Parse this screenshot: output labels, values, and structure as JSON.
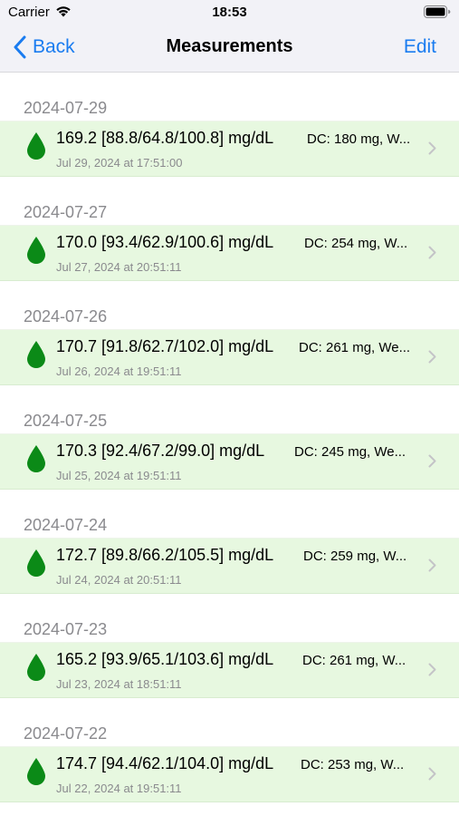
{
  "status_bar": {
    "carrier": "Carrier",
    "time": "18:53"
  },
  "nav": {
    "back_label": "Back",
    "title": "Measurements",
    "edit_label": "Edit"
  },
  "colors": {
    "accent": "#1a7cf0",
    "row_background": "#e7f8e0",
    "drop_green": "#0b8a17"
  },
  "sections": [
    {
      "header": "2024-07-29",
      "title": "169.2 [88.8/64.8/100.8] mg/dL",
      "detail": "DC: 180 mg, W...",
      "subtitle": "Jul 29, 2024 at 17:51:00"
    },
    {
      "header": "2024-07-27",
      "title": "170.0 [93.4/62.9/100.6] mg/dL",
      "detail": "DC: 254 mg, W...",
      "subtitle": "Jul 27, 2024 at 20:51:11"
    },
    {
      "header": "2024-07-26",
      "title": "170.7 [91.8/62.7/102.0] mg/dL",
      "detail": "DC: 261 mg, We...",
      "subtitle": "Jul 26, 2024 at 19:51:11"
    },
    {
      "header": "2024-07-25",
      "title": "170.3 [92.4/67.2/99.0] mg/dL",
      "detail": "DC: 245 mg, We...",
      "subtitle": "Jul 25, 2024 at 19:51:11"
    },
    {
      "header": "2024-07-24",
      "title": "172.7 [89.8/66.2/105.5] mg/dL",
      "detail": "DC: 259 mg, W...",
      "subtitle": "Jul 24, 2024 at 20:51:11"
    },
    {
      "header": "2024-07-23",
      "title": "165.2 [93.9/65.1/103.6] mg/dL",
      "detail": "DC: 261 mg, W...",
      "subtitle": "Jul 23, 2024 at 18:51:11"
    },
    {
      "header": "2024-07-22",
      "title": "174.7 [94.4/62.1/104.0] mg/dL",
      "detail": "DC: 253 mg, W...",
      "subtitle": "Jul 22, 2024 at 19:51:11"
    }
  ]
}
